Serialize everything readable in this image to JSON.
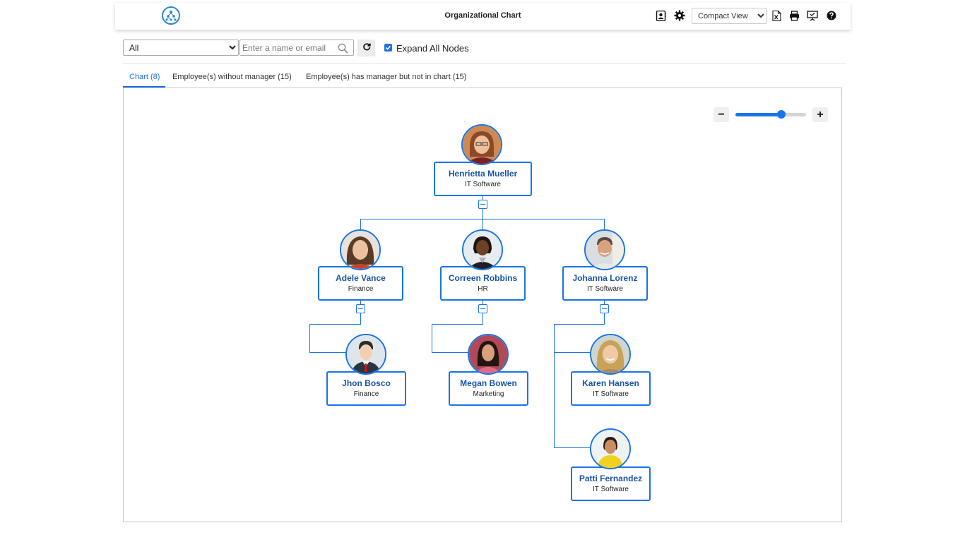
{
  "header": {
    "title": "Organizational Chart",
    "view_select": {
      "value": "Compact View",
      "options": [
        "Compact View"
      ]
    }
  },
  "toolbar": {
    "filter_select": {
      "value": "All",
      "options": [
        "All"
      ]
    },
    "search_placeholder": "Enter a name or email",
    "expand_all_label": "Expand All Nodes",
    "expand_all_checked": true
  },
  "tabs": [
    {
      "label": "Chart (8)",
      "active": true
    },
    {
      "label": "Employee(s) without manager (15)",
      "active": false
    },
    {
      "label": "Employee(s) has manager but not in chart (15)",
      "active": false
    }
  ],
  "zoom": {
    "level": 0.65
  },
  "accent_color": "#1a73e8",
  "org": {
    "root": {
      "name": "Henrietta Mueller",
      "dept": "IT Software"
    },
    "adele": {
      "name": "Adele Vance",
      "dept": "Finance"
    },
    "correen": {
      "name": "Correen Robbins",
      "dept": "HR"
    },
    "johanna": {
      "name": "Johanna  Lorenz",
      "dept": "IT Software"
    },
    "jhon": {
      "name": "Jhon Bosco",
      "dept": "Finance"
    },
    "megan": {
      "name": "Megan Bowen",
      "dept": "Marketing"
    },
    "karen": {
      "name": "Karen Hansen",
      "dept": "IT Software"
    },
    "patti": {
      "name": "Patti Fernandez",
      "dept": "IT Software"
    }
  }
}
